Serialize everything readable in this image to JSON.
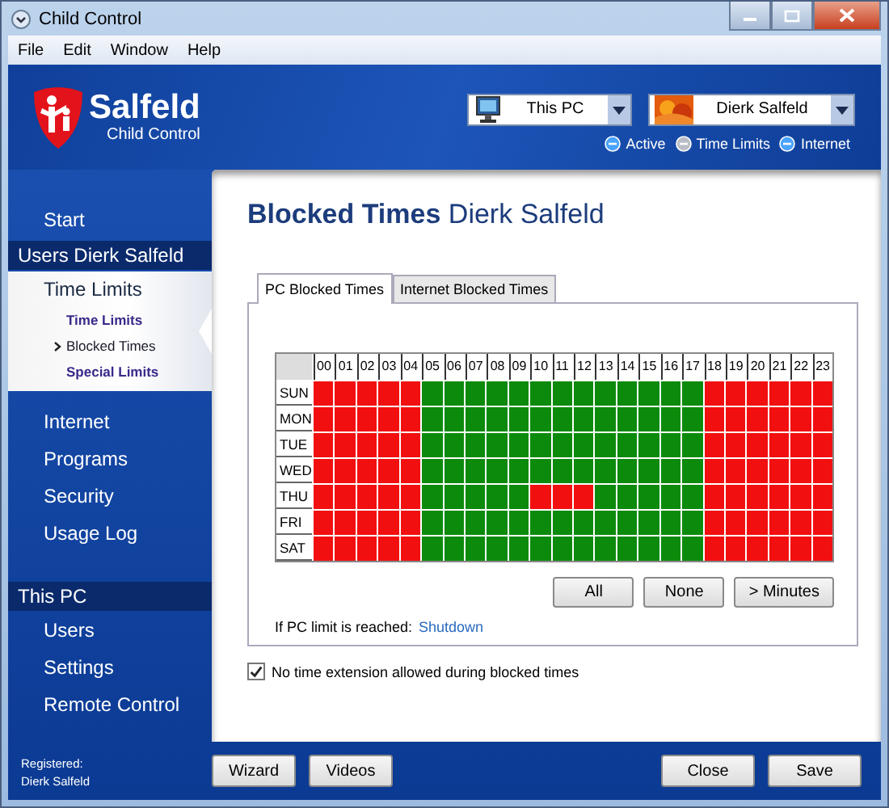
{
  "window": {
    "title": "Child Control"
  },
  "menu": [
    "File",
    "Edit",
    "Window",
    "Help"
  ],
  "header": {
    "brand": "Salfeld",
    "subtitle": "Child Control",
    "selectors": [
      {
        "kind": "computer",
        "value": "This PC"
      },
      {
        "kind": "user",
        "value": "Dierk Salfeld"
      }
    ],
    "indicators": [
      {
        "label": "Active",
        "on": true
      },
      {
        "label": "Time Limits",
        "on": false
      },
      {
        "label": "Internet",
        "on": true
      }
    ]
  },
  "sidebar": {
    "items": [
      {
        "kind": "item",
        "label": "Start"
      },
      {
        "kind": "header",
        "label": "Users Dierk Salfeld"
      },
      {
        "kind": "group",
        "label": "Time Limits",
        "expanded": true,
        "children": [
          {
            "label": "Time Limits",
            "selected": false
          },
          {
            "label": "Blocked Times",
            "selected": true
          },
          {
            "label": "Special Limits",
            "selected": false
          }
        ]
      },
      {
        "kind": "item",
        "label": "Internet"
      },
      {
        "kind": "item",
        "label": "Programs"
      },
      {
        "kind": "item",
        "label": "Security"
      },
      {
        "kind": "item",
        "label": "Usage Log"
      },
      {
        "kind": "header",
        "label": "This PC"
      },
      {
        "kind": "item",
        "label": "Users"
      },
      {
        "kind": "item",
        "label": "Settings"
      },
      {
        "kind": "item",
        "label": "Remote Control"
      }
    ],
    "registered": [
      "Registered:",
      "Dierk Salfeld"
    ]
  },
  "page": {
    "title": "Blocked Times",
    "subject": "Dierk Salfeld"
  },
  "tabs": [
    {
      "label": "PC Blocked Times",
      "selected": true
    },
    {
      "label": "Internet Blocked Times",
      "selected": false
    }
  ],
  "grid": {
    "hours": [
      "00",
      "01",
      "02",
      "03",
      "04",
      "05",
      "06",
      "07",
      "08",
      "09",
      "10",
      "11",
      "12",
      "13",
      "14",
      "15",
      "16",
      "17",
      "18",
      "19",
      "20",
      "21",
      "22",
      "23"
    ],
    "rows": [
      {
        "day": "SUN",
        "blocked": [
          true,
          true,
          true,
          true,
          true,
          false,
          false,
          false,
          false,
          false,
          false,
          false,
          false,
          false,
          false,
          false,
          false,
          false,
          true,
          true,
          true,
          true,
          true,
          true
        ]
      },
      {
        "day": "MON",
        "blocked": [
          true,
          true,
          true,
          true,
          true,
          false,
          false,
          false,
          false,
          false,
          false,
          false,
          false,
          false,
          false,
          false,
          false,
          false,
          true,
          true,
          true,
          true,
          true,
          true
        ]
      },
      {
        "day": "TUE",
        "blocked": [
          true,
          true,
          true,
          true,
          true,
          false,
          false,
          false,
          false,
          false,
          false,
          false,
          false,
          false,
          false,
          false,
          false,
          false,
          true,
          true,
          true,
          true,
          true,
          true
        ]
      },
      {
        "day": "WED",
        "blocked": [
          true,
          true,
          true,
          true,
          true,
          false,
          false,
          false,
          false,
          false,
          false,
          false,
          false,
          false,
          false,
          false,
          false,
          false,
          true,
          true,
          true,
          true,
          true,
          true
        ]
      },
      {
        "day": "THU",
        "blocked": [
          true,
          true,
          true,
          true,
          true,
          false,
          false,
          false,
          false,
          false,
          true,
          true,
          true,
          false,
          false,
          false,
          false,
          false,
          true,
          true,
          true,
          true,
          true,
          true
        ]
      },
      {
        "day": "FRI",
        "blocked": [
          true,
          true,
          true,
          true,
          true,
          false,
          false,
          false,
          false,
          false,
          false,
          false,
          false,
          false,
          false,
          false,
          false,
          false,
          true,
          true,
          true,
          true,
          true,
          true
        ]
      },
      {
        "day": "SAT",
        "blocked": [
          true,
          true,
          true,
          true,
          true,
          false,
          false,
          false,
          false,
          false,
          false,
          false,
          false,
          false,
          false,
          false,
          false,
          false,
          true,
          true,
          true,
          true,
          true,
          true
        ]
      }
    ]
  },
  "grid_buttons": [
    "All",
    "None",
    "> Minutes"
  ],
  "limit": {
    "label": "If PC limit is reached:",
    "action": "Shutdown"
  },
  "option": {
    "label": "No time extension allowed during blocked times",
    "checked": true
  },
  "footer_buttons": {
    "left": [
      "Wizard",
      "Videos"
    ],
    "right": [
      "Close",
      "Save"
    ]
  }
}
